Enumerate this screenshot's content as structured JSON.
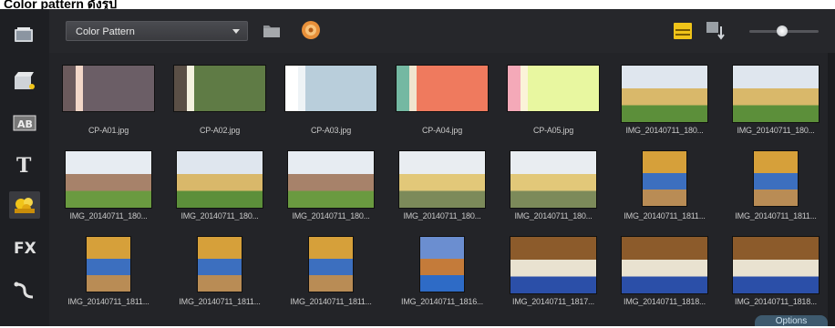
{
  "caption": "Color pattern ดังรูป",
  "toolbar": {
    "library_dropdown_value": "Color Pattern",
    "accent_color": "#f0c419"
  },
  "sidebar": {
    "items": [
      {
        "name": "media-icon"
      },
      {
        "name": "instant-project-icon"
      },
      {
        "name": "transition-icon"
      },
      {
        "name": "title-icon",
        "label": "T"
      },
      {
        "name": "graphic-icon",
        "active": true
      },
      {
        "name": "filter-icon",
        "label": "FX"
      },
      {
        "name": "path-icon"
      }
    ]
  },
  "grid": {
    "items": [
      {
        "label": "CP-A01.jpg",
        "kind": "swatch",
        "colors": [
          "#6b5a5c",
          "#f3d7c8",
          "#6b5e66"
        ]
      },
      {
        "label": "CP-A02.jpg",
        "kind": "swatch",
        "colors": [
          "#5a4f46",
          "#f4f1df",
          "#5f7b45"
        ]
      },
      {
        "label": "CP-A03.jpg",
        "kind": "swatch",
        "colors": [
          "#ffffff",
          "#eef3f6",
          "#b9cedb"
        ]
      },
      {
        "label": "CP-A04.jpg",
        "kind": "swatch",
        "colors": [
          "#74b8a2",
          "#f0e5cf",
          "#ef7a5e"
        ]
      },
      {
        "label": "CP-A05.jpg",
        "kind": "swatch",
        "colors": [
          "#f4a9b8",
          "#fbf3d8",
          "#e8f7a0"
        ]
      },
      {
        "label": "IMG_20140711_180...",
        "kind": "photo",
        "palette": "temple"
      },
      {
        "label": "IMG_20140711_180...",
        "kind": "photo",
        "palette": "temple"
      },
      {
        "label": "IMG_20140711_180...",
        "kind": "photo",
        "palette": "building"
      },
      {
        "label": "IMG_20140711_180...",
        "kind": "photo",
        "palette": "temple"
      },
      {
        "label": "IMG_20140711_180...",
        "kind": "photo",
        "palette": "building"
      },
      {
        "label": "IMG_20140711_180...",
        "kind": "photo",
        "palette": "stupa"
      },
      {
        "label": "IMG_20140711_180...",
        "kind": "photo",
        "palette": "stupa"
      },
      {
        "label": "IMG_20140711_1811...",
        "kind": "photo",
        "palette": "interior"
      },
      {
        "label": "IMG_20140711_1811...",
        "kind": "photo",
        "palette": "interior"
      },
      {
        "label": "IMG_20140711_1811...",
        "kind": "photo",
        "palette": "interior"
      },
      {
        "label": "IMG_20140711_1811...",
        "kind": "photo",
        "palette": "interior"
      },
      {
        "label": "IMG_20140711_1811...",
        "kind": "photo",
        "palette": "interior"
      },
      {
        "label": "IMG_20140711_1816...",
        "kind": "photo",
        "palette": "hall"
      },
      {
        "label": "IMG_20140711_1817...",
        "kind": "photo",
        "palette": "crowd"
      },
      {
        "label": "IMG_20140711_1818...",
        "kind": "photo",
        "palette": "crowd"
      },
      {
        "label": "IMG_20140711_1818...",
        "kind": "photo",
        "palette": "crowd"
      }
    ]
  },
  "options_label": "Options"
}
